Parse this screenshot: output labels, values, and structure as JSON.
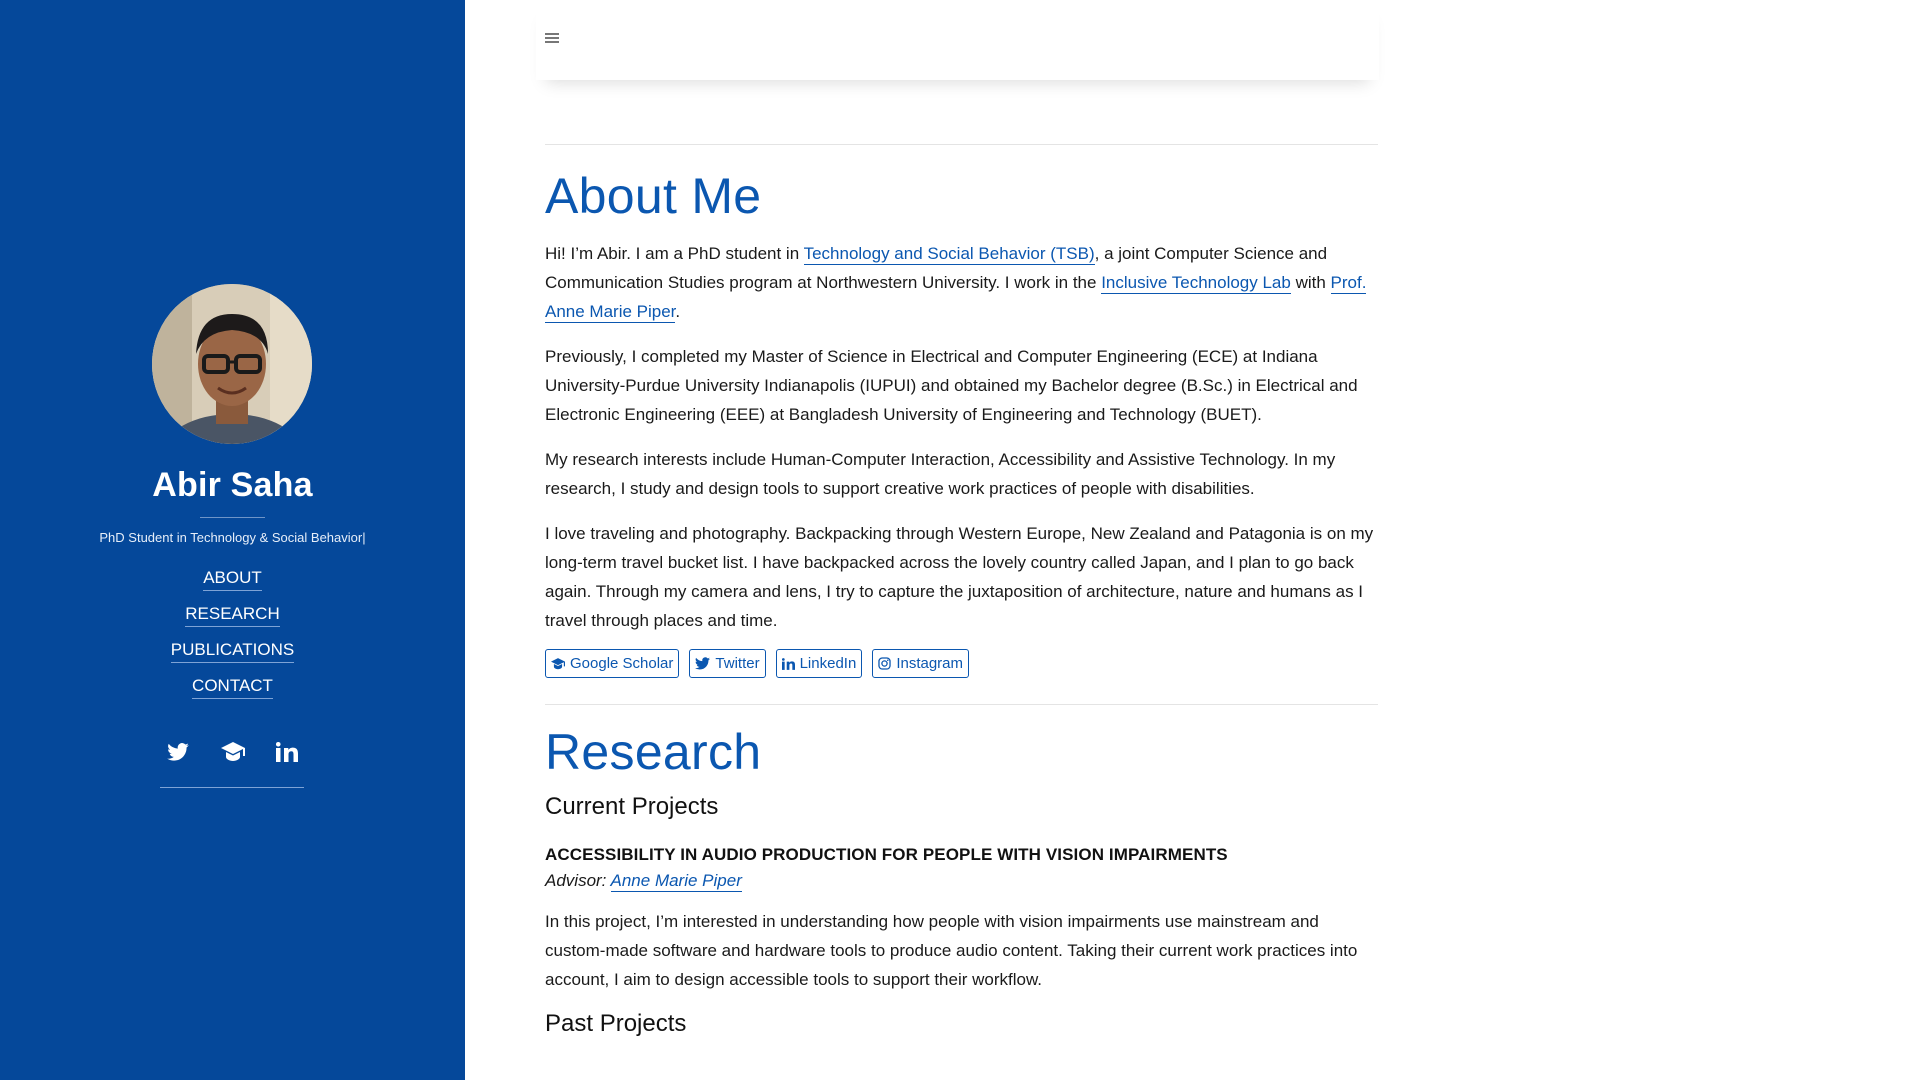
{
  "sidebar": {
    "name": "Abir Saha",
    "subtitle": "PhD Student in Technology & Social Behavior|",
    "nav": [
      "ABOUT",
      "RESEARCH",
      "PUBLICATIONS",
      "CONTACT"
    ],
    "social_icons": [
      "twitter-icon",
      "graduation-cap-icon",
      "linkedin-icon"
    ]
  },
  "topbar": {
    "menu_icon": "hamburger-icon"
  },
  "about": {
    "heading": "About Me",
    "p1": {
      "t1": "Hi! I’m Abir. I am a PhD student in ",
      "link1": "Technology and Social Behavior (TSB)",
      "t2": ", a joint Computer Science and Communication Studies program at Northwestern University. I work in the ",
      "link2": "Inclusive Technology Lab",
      "t3": " with ",
      "link3": "Prof. Anne Marie Piper",
      "t4": "."
    },
    "p2": "Previously, I completed my Master of Science in Electrical and Computer Engineering (ECE) at Indiana University-Purdue University Indianapolis (IUPUI) and obtained my Bachelor degree (B.Sc.) in Electrical and Electronic Engineering (EEE) at Bangladesh University of Engineering and Technology (BUET).",
    "p3": "My research interests include Human-Computer Interaction, Accessibility and Assistive Technology. In my research, I study and design tools to support creative work practices of people with disabilities.",
    "p4": "I love traveling and photography. Backpacking through Western Europe, New Zealand and Patagonia is on my long-term travel bucket list. I have backpacked across the lovely country called Japan, and I plan to go back again. Through my camera and lens, I try to capture the juxtaposition of architecture, nature and humans as I travel through places and time.",
    "buttons": [
      {
        "label": "Google Scholar",
        "icon": "graduation-cap-icon"
      },
      {
        "label": "Twitter",
        "icon": "twitter-icon"
      },
      {
        "label": "LinkedIn",
        "icon": "linkedin-icon"
      },
      {
        "label": "Instagram",
        "icon": "instagram-icon"
      }
    ]
  },
  "research": {
    "heading": "Research",
    "current_heading": "Current Projects",
    "project_title": "ACCESSIBILITY IN AUDIO PRODUCTION FOR PEOPLE WITH VISION IMPAIRMENTS",
    "advisor_label": "Advisor: ",
    "advisor_name": "Anne Marie Piper",
    "project_desc": "In this project, I’m interested in understanding how people with vision impairments use mainstream and custom-made software and hardware tools to produce audio content. Taking their current work practices into account, I aim to design accessible tools to support their workflow.",
    "past_heading": "Past Projects"
  },
  "colors": {
    "sidebar": "#05489a",
    "accent": "#0b57b0"
  }
}
